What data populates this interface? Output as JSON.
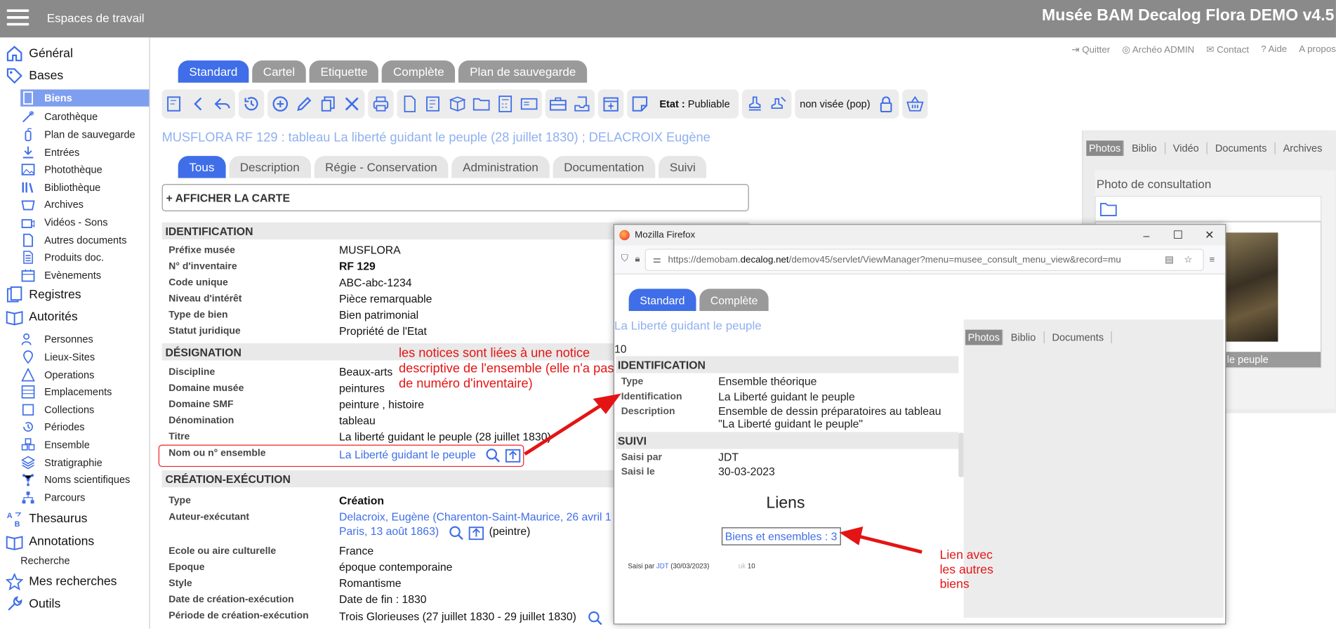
{
  "topbar": {
    "workspaces": "Espaces de travail",
    "title": "Musée BAM Decalog Flora DEMO v4.5"
  },
  "sidebar": {
    "general": "Général",
    "bases": "Bases",
    "bases_items": [
      "Biens",
      "Carothèque",
      "Plan de sauvegarde",
      "Entrées",
      "Photothèque",
      "Bibliothèque",
      "Archives",
      "Vidéos - Sons",
      "Autres documents",
      "Produits doc.",
      "Evènements"
    ],
    "registres": "Registres",
    "autorites": "Autorités",
    "autorites_items": [
      "Personnes",
      "Lieux-Sites",
      "Operations",
      "Emplacements",
      "Collections",
      "Périodes",
      "Ensemble",
      "Stratigraphie",
      "Noms scientifiques",
      "Parcours"
    ],
    "thesaurus": "Thesaurus",
    "annotations": "Annotations",
    "recherche": "Recherche",
    "mes_recherches": "Mes recherches",
    "outils": "Outils"
  },
  "toplinks": [
    "Quitter",
    "Archéo ADMIN",
    "Contact",
    "Aide",
    "A propos"
  ],
  "view_tabs": [
    "Standard",
    "Cartel",
    "Etiquette",
    "Complète",
    "Plan de sauvegarde"
  ],
  "toolbar": {
    "etat_label": "Etat :",
    "etat_value": "Publiable",
    "visa": "non visée (pop)"
  },
  "record_title": "MUSFLORA RF 129 : tableau La liberté guidant le peuple (28 juillet 1830) ; DELACROIX Eugène",
  "section_tabs": [
    "Tous",
    "Description",
    "Régie - Conservation",
    "Administration",
    "Documentation",
    "Suivi"
  ],
  "map_button": "+ AFFICHER LA CARTE",
  "sections": {
    "identification": "IDENTIFICATION",
    "designation": "DÉSIGNATION",
    "creation": "CRÉATION-EXÉCUTION"
  },
  "identification": [
    {
      "label": "Préfixe musée",
      "value": "MUSFLORA"
    },
    {
      "label": "N° d'inventaire",
      "value": "RF 129"
    },
    {
      "label": "Code unique",
      "value": "ABC-abc-1234"
    },
    {
      "label": "Niveau d'intérêt",
      "value": "Pièce remarquable"
    },
    {
      "label": "Type de bien",
      "value": "Bien patrimonial"
    },
    {
      "label": "Statut juridique",
      "value": "Propriété de l'Etat"
    }
  ],
  "designation": [
    {
      "label": "Discipline",
      "value": "Beaux-arts"
    },
    {
      "label": "Domaine musée",
      "value": "peintures"
    },
    {
      "label": "Domaine SMF",
      "value": "peinture , histoire"
    },
    {
      "label": "Dénomination",
      "value": "tableau"
    },
    {
      "label": "Titre",
      "value": "La liberté guidant le peuple (28 juillet 1830)"
    },
    {
      "label": "Nom ou n° ensemble",
      "value": "La Liberté guidant le peuple"
    }
  ],
  "creation": {
    "type_label": "Type",
    "type_value": "Création",
    "auteur_label": "Auteur-exécutant",
    "auteur_line1": "Delacroix, Eugène (Charenton-Saint-Maurice, 26 avril 1",
    "auteur_line2": "Paris, 13 août 1863)",
    "auteur_role": "(peintre)",
    "rows": [
      {
        "label": "Ecole ou aire culturelle",
        "value": "France"
      },
      {
        "label": "Epoque",
        "value": "époque contemporaine"
      },
      {
        "label": "Style",
        "value": "Romantisme"
      },
      {
        "label": "Date de création-exécution",
        "value": "Date de fin : 1830"
      },
      {
        "label": "Période de création-exécution",
        "value": "Trois Glorieuses (27 juillet 1830 - 29 juillet 1830)"
      }
    ]
  },
  "right_panel": {
    "tabs": [
      "Photos",
      "Biblio",
      "Vidéo",
      "Documents",
      "Archives"
    ],
    "photo_title": "Photo de consultation",
    "caption": "le peuple"
  },
  "annotations": {
    "a1": [
      "les notices sont liées à une notice",
      "descriptive de l'ensemble (elle n'a pas",
      "de numéro d'inventaire)"
    ],
    "a2": [
      "Lien avec",
      "les autres",
      "biens"
    ]
  },
  "popup": {
    "window_title": "Mozilla Firefox",
    "url_pre": "https://demobam.",
    "url_domain": "decalog.net",
    "url_post": "/demov45/servlet/ViewManager?menu=musee_consult_menu_view&record=mu",
    "tabs": [
      "Standard",
      "Complète"
    ],
    "title": "La Liberté guidant le peuple",
    "number": "10",
    "ident_header": "IDENTIFICATION",
    "ident": [
      {
        "label": "Type",
        "value": "Ensemble théorique"
      },
      {
        "label": "Identification",
        "value": "La Liberté guidant le peuple"
      },
      {
        "label": "Description",
        "value": "Ensemble de dessin préparatoires au tableau",
        "value2": "\"La Liberté guidant le peuple\""
      }
    ],
    "suivi_header": "SUIVI",
    "suivi": [
      {
        "label": "Saisi par",
        "value": "JDT"
      },
      {
        "label": "Saisi le",
        "value": "30-03-2023"
      }
    ],
    "liens": "Liens",
    "liens_link": "Biens et ensembles : 3",
    "footer_a": "Saisi par",
    "footer_user": "JDT",
    "footer_date": "(30/03/2023)",
    "footer_uk": "uk",
    "footer_num": "10",
    "right_tabs": [
      "Photos",
      "Biblio",
      "Documents"
    ]
  },
  "colors": {
    "accent": "#3f6ee8",
    "annotation": "#e41414",
    "topbar": "#8a8a8a"
  }
}
